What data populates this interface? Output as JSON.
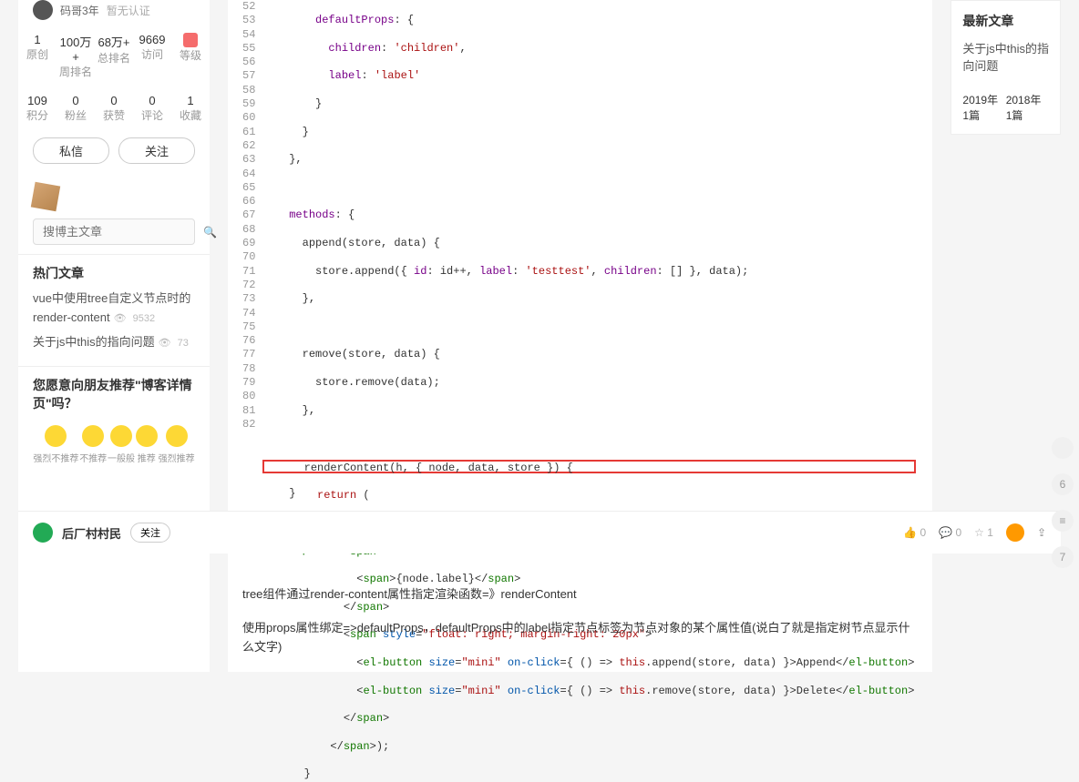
{
  "user": {
    "name": "码哥3年",
    "verify": "暂无认证"
  },
  "stats1": [
    {
      "n": "1",
      "l": "原创"
    },
    {
      "n": "100万+",
      "l": "周排名"
    },
    {
      "n": "68万+",
      "l": "总排名"
    },
    {
      "n": "9669",
      "l": "访问"
    },
    {
      "n": "",
      "l": "等级"
    }
  ],
  "stats2": [
    {
      "n": "109",
      "l": "积分"
    },
    {
      "n": "0",
      "l": "粉丝"
    },
    {
      "n": "0",
      "l": "获赞"
    },
    {
      "n": "0",
      "l": "评论"
    },
    {
      "n": "1",
      "l": "收藏"
    }
  ],
  "btn_msg": "私信",
  "btn_follow": "关注",
  "search_ph": "搜博主文章",
  "hot_title": "热门文章",
  "hot": [
    {
      "t": "vue中使用tree自定义节点时的render-content",
      "v": "9532"
    },
    {
      "t": "关于js中this的指向问题",
      "v": "73"
    }
  ],
  "rec_title": "您愿意向朋友推荐\"博客详情页\"吗？",
  "rec": [
    {
      "l": "强烈不推荐"
    },
    {
      "l": "不推荐"
    },
    {
      "l": "一般般"
    },
    {
      "l": "推荐"
    },
    {
      "l": "强烈推荐"
    }
  ],
  "right_title": "最新文章",
  "right_art": "关于js中this的指向问题",
  "year1": "2019年  1篇",
  "year2": "2018年  1篇",
  "p1": "tree组件通过render-content属性指定渲染函数=》renderContent",
  "p2": "使用props属性绑定=>defaultProps，defaultProps中的label指定节点标签为节点对象的某个属性值(说白了就是指定树节点显示什么文字)",
  "author": "后厂村村民",
  "follow2": "关注",
  "like": "0",
  "comment": "0",
  "star": "1",
  "lines": [
    "52",
    "53",
    "54",
    "55",
    "56",
    "57",
    "58",
    "59",
    "60",
    "61",
    "62",
    "63",
    "64",
    "65",
    "66",
    "67",
    "68",
    "69",
    "70",
    "71",
    "72",
    "73",
    "74",
    "75",
    "76",
    "77",
    "78",
    "79",
    "80",
    "81",
    "82"
  ]
}
